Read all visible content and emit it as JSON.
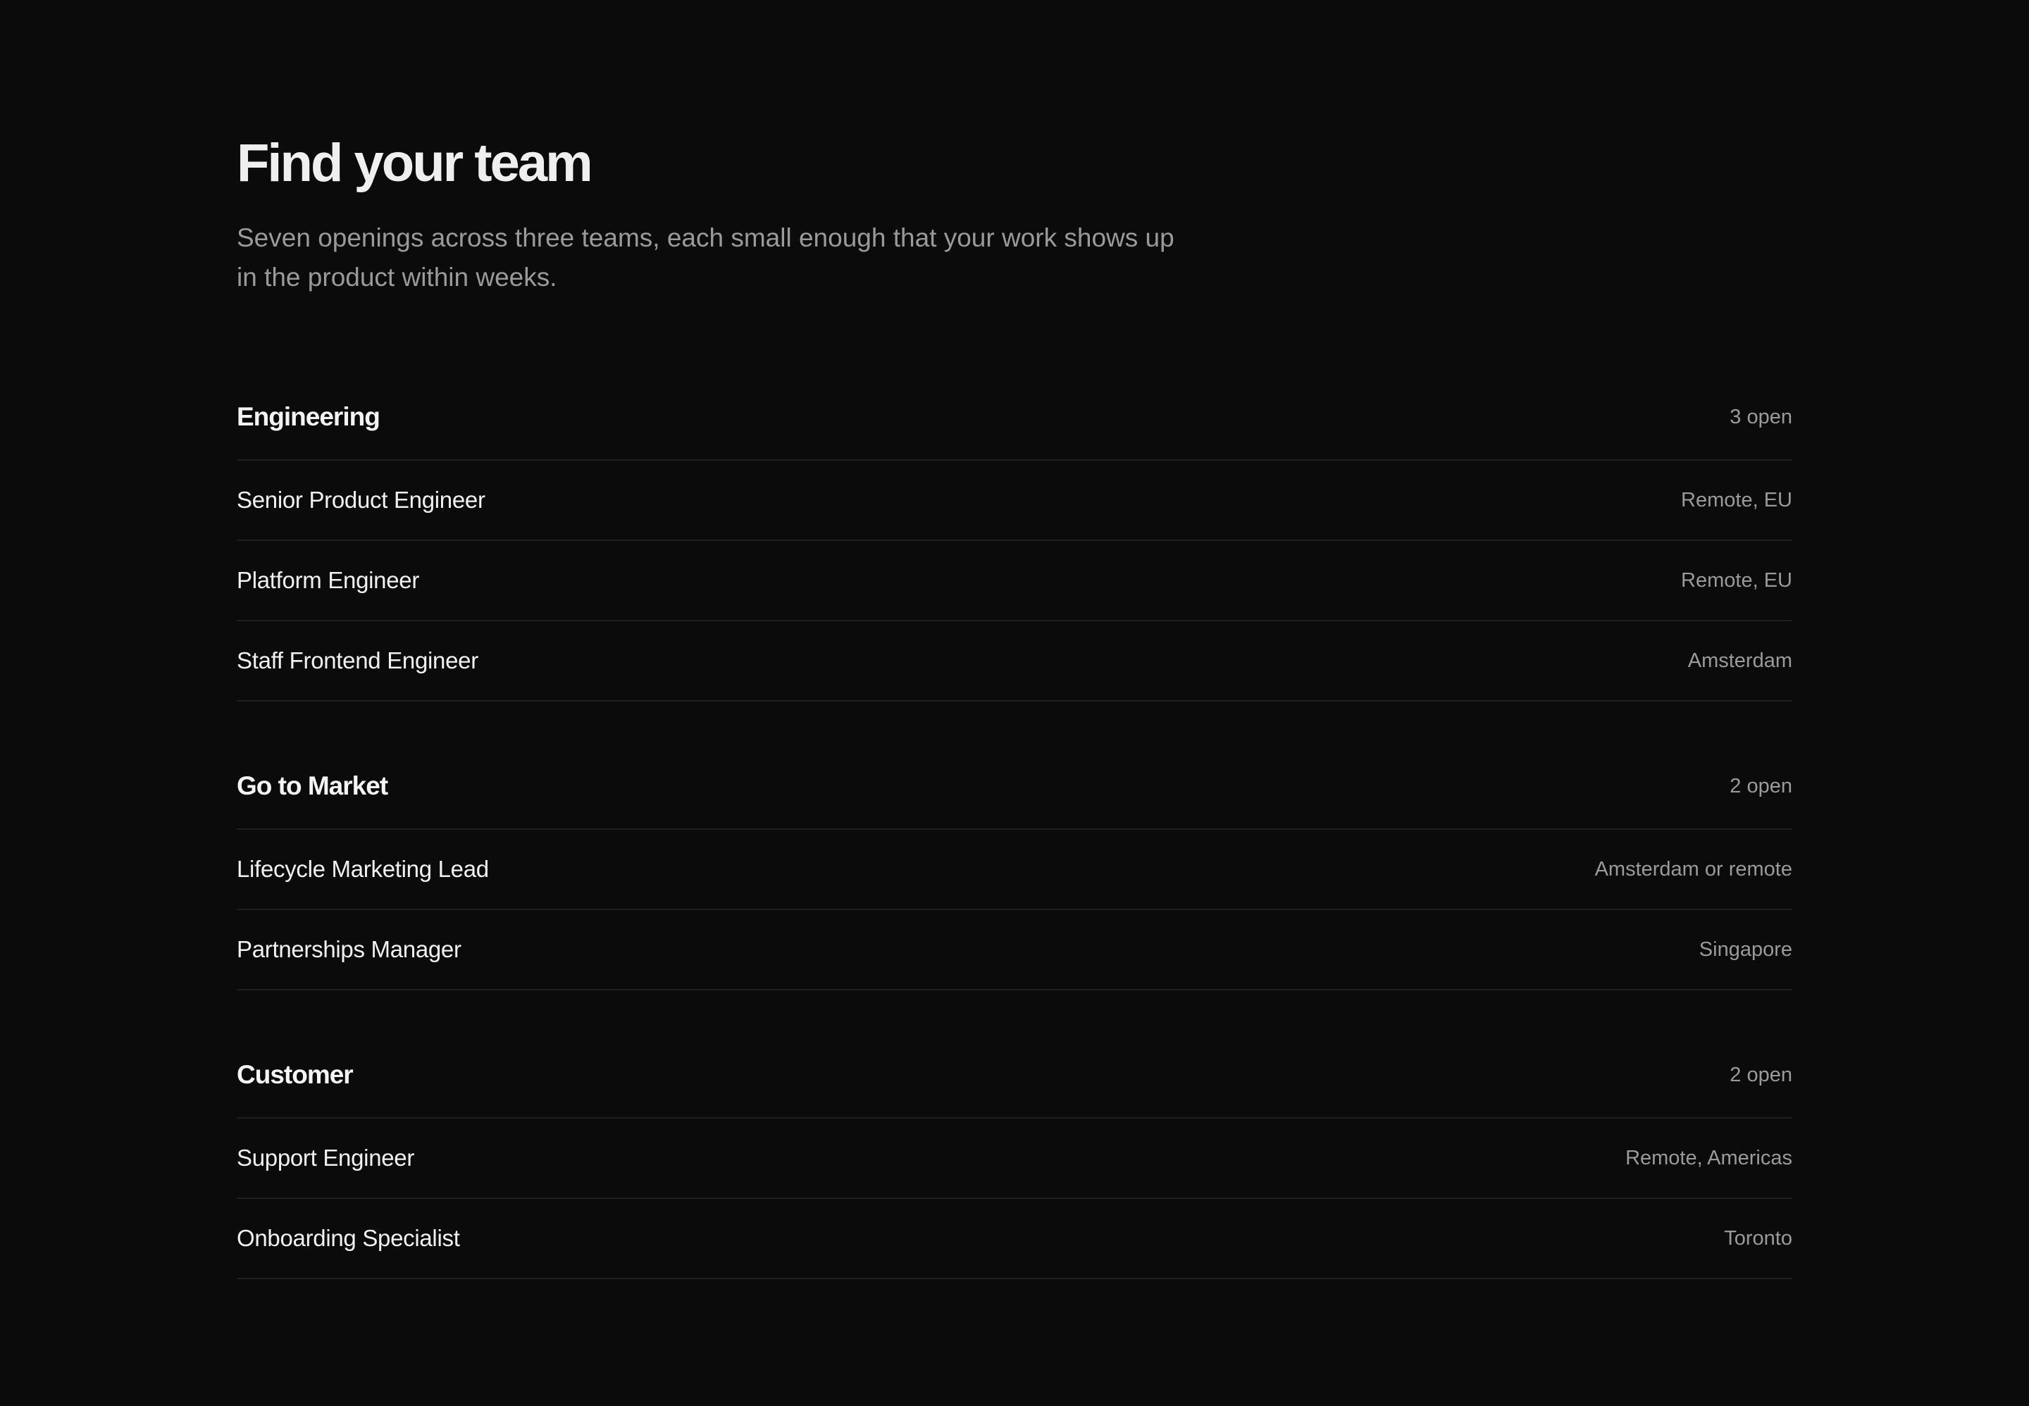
{
  "header": {
    "title": "Find your team",
    "subtitle": "Seven openings across three teams, each small enough that your work shows up in the product within weeks."
  },
  "teams": [
    {
      "name": "Engineering",
      "count": "3 open",
      "jobs": [
        {
          "title": "Senior Product Engineer",
          "location": "Remote, EU"
        },
        {
          "title": "Platform Engineer",
          "location": "Remote, EU"
        },
        {
          "title": "Staff Frontend Engineer",
          "location": "Amsterdam"
        }
      ]
    },
    {
      "name": "Go to Market",
      "count": "2 open",
      "jobs": [
        {
          "title": "Lifecycle Marketing Lead",
          "location": "Amsterdam or remote"
        },
        {
          "title": "Partnerships Manager",
          "location": "Singapore"
        }
      ]
    },
    {
      "name": "Customer",
      "count": "2 open",
      "jobs": [
        {
          "title": "Support Engineer",
          "location": "Remote, Americas"
        },
        {
          "title": "Onboarding Specialist",
          "location": "Toronto"
        }
      ]
    }
  ]
}
